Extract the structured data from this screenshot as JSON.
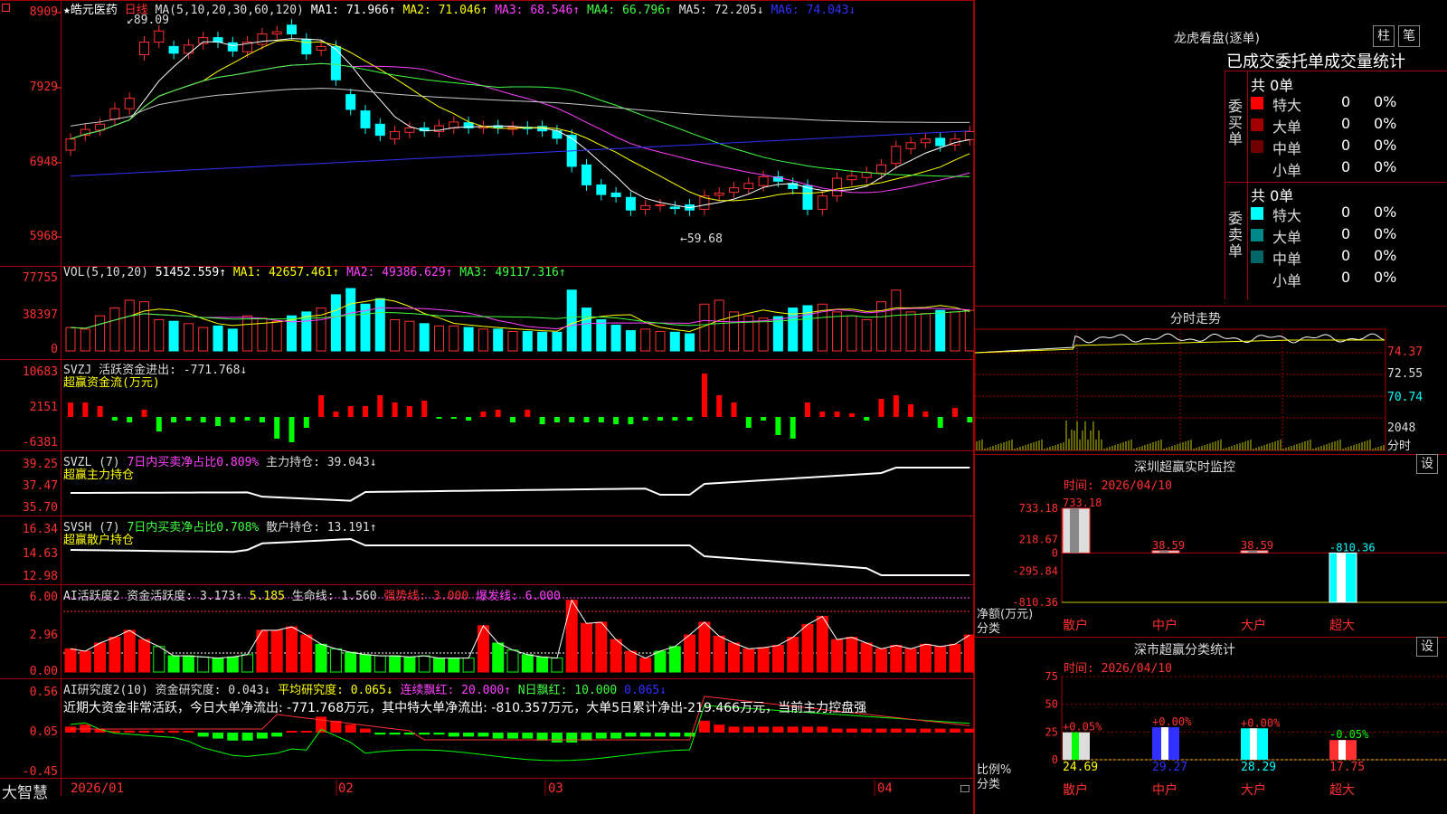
{
  "stock": {
    "name": "★皓元医药",
    "period": "日线"
  },
  "price_panel": {
    "y_labels": [
      "8909",
      "7929",
      "6948",
      "5968"
    ],
    "ma_header": [
      {
        "text": "MA(5,10,20,30,60,120)",
        "color": "#dddddd"
      },
      {
        "text": "MA1: 71.966↑",
        "color": "#ffffff"
      },
      {
        "text": "MA2: 71.046↑",
        "color": "#ffff00"
      },
      {
        "text": "MA3: 68.546↑",
        "color": "#ff40ff"
      },
      {
        "text": "MA4: 66.796↑",
        "color": "#40ff40"
      },
      {
        "text": "MA5: 72.205↓",
        "color": "#dddddd"
      },
      {
        "text": "MA6: 74.043↓",
        "color": "#3030ff"
      }
    ],
    "high_mark": "89.09",
    "low_mark": "←59.68"
  },
  "vol_panel": {
    "y_labels": [
      "77755",
      "38397",
      "0"
    ],
    "header": [
      {
        "text": "VOL(5,10,20)",
        "color": "#dddddd"
      },
      {
        "text": "51452.559↑",
        "color": "#ffffff"
      },
      {
        "text": "MA1: 42657.461↑",
        "color": "#ffff00"
      },
      {
        "text": "MA2: 49386.629↑",
        "color": "#ff40ff"
      },
      {
        "text": "MA3: 49117.316↑",
        "color": "#40ff40"
      }
    ]
  },
  "svzj_panel": {
    "y_labels": [
      "10683",
      "2151",
      "-6381"
    ],
    "header": [
      {
        "text": "SVZJ  活跃资金进出: -771.768↓",
        "color": "#dddddd"
      }
    ],
    "subtitle": "超赢资金流(万元)"
  },
  "svzl_panel": {
    "y_labels": [
      "39.25",
      "37.47",
      "35.70"
    ],
    "header": [
      {
        "text": "SVZL (7)",
        "color": "#dddddd"
      },
      {
        "text": "7日内买卖净占比0.809%",
        "color": "#ff40ff"
      },
      {
        "text": "主力持仓: 39.043↓",
        "color": "#dddddd"
      }
    ],
    "subtitle": "超赢主力持仓"
  },
  "svsh_panel": {
    "y_labels": [
      "16.34",
      "14.63",
      "12.98"
    ],
    "header": [
      {
        "text": "SVSH (7)",
        "color": "#dddddd"
      },
      {
        "text": "7日内买卖净占比0.708%",
        "color": "#40ff40"
      },
      {
        "text": "散户持仓: 13.191↑",
        "color": "#dddddd"
      }
    ],
    "subtitle": "超赢散户持仓"
  },
  "ai_active_panel": {
    "y_labels": [
      "6.00",
      "2.96",
      "0.00"
    ],
    "header": [
      {
        "text": "AI活跃度2",
        "color": "#dddddd"
      },
      {
        "text": "资金活跃度: 3.173↑",
        "color": "#dddddd"
      },
      {
        "text": "5.185",
        "color": "#ffff00"
      },
      {
        "text": "生命线: 1.560",
        "color": "#dddddd"
      },
      {
        "text": "强势线: 3.000",
        "color": "#ff3030"
      },
      {
        "text": "爆发线: 6.000",
        "color": "#ff40ff"
      }
    ]
  },
  "ai_research_panel": {
    "y_labels": [
      "0.56",
      "0.05",
      "-0.45"
    ],
    "header": [
      {
        "text": "AI研究度2(10)",
        "color": "#dddddd"
      },
      {
        "text": "资金研究度: 0.043↓",
        "color": "#dddddd"
      },
      {
        "text": "平均研究度: 0.065↓",
        "color": "#ffff00"
      },
      {
        "text": "连续飘红: 20.000↑",
        "color": "#ff40ff"
      },
      {
        "text": "N日飘红: 10.000",
        "color": "#40ff40"
      },
      {
        "text": "0.065↓",
        "color": "#3030ff"
      }
    ],
    "comment": "近期大资金非常活跃，今日大单净流出: -771.768万元，其中特大单净流出: -810.357万元，大单5日累计净出-219.466万元，当前主力控盘强"
  },
  "x_axis": {
    "brand": "大智慧",
    "labels": [
      "2026/01",
      "02",
      "03",
      "04"
    ]
  },
  "right": {
    "lhb_title": "龙虎看盘(逐单)",
    "btn_zhu": "柱",
    "btn_bi": "笔",
    "order_title": "已成交委托单成交量统计",
    "buy_label": "委买单",
    "sell_label": "委卖单",
    "buy_total": "共 0单",
    "sell_total": "共 0单",
    "buy_rows": [
      {
        "label": "特大",
        "count": "0",
        "pct": "0%",
        "color": "#ff0000"
      },
      {
        "label": "大单",
        "count": "0",
        "pct": "0%",
        "color": "#a00000"
      },
      {
        "label": "中单",
        "count": "0",
        "pct": "0%",
        "color": "#700000"
      },
      {
        "label": "小单",
        "count": "0",
        "pct": "0%",
        "color": "#000000"
      }
    ],
    "sell_rows": [
      {
        "label": "特大",
        "count": "0",
        "pct": "0%",
        "color": "#00ffff"
      },
      {
        "label": "大单",
        "count": "0",
        "pct": "0%",
        "color": "#008888"
      },
      {
        "label": "中单",
        "count": "0",
        "pct": "0%",
        "color": "#006666"
      },
      {
        "label": "小单",
        "count": "0",
        "pct": "0%",
        "color": "#000000"
      }
    ],
    "intraday_title": "分时走势",
    "intraday_labels": [
      "74.37",
      "72.55",
      "70.74",
      "2048",
      "分时"
    ],
    "sz_monitor_title": "深圳超赢实时监控",
    "sz_time": "时间: 2026/04/10",
    "sz_y_labels": [
      "733.18",
      "218.67",
      "0",
      "-295.84",
      "-810.36"
    ],
    "sz_values": [
      733.18,
      38.59,
      38.59,
      -810.36
    ],
    "sz_value_labels": [
      "733.18",
      "38.59",
      "38.59",
      "-810.36"
    ],
    "sz_axis_label": "净额(万元)",
    "sz_axis_label2": "分类",
    "categories": [
      "散户",
      "中户",
      "大户",
      "超大"
    ],
    "set_btn": "设",
    "cls_title": "深市超赢分类统计",
    "cls_time": "时间: 2026/04/10",
    "cls_y_labels": [
      "75",
      "50",
      "25",
      "0"
    ],
    "cls_values": [
      24.69,
      29.27,
      28.29,
      17.75
    ],
    "cls_value_labels": [
      "24.69",
      "29.27",
      "28.29",
      "17.75"
    ],
    "cls_change_labels": [
      "+0.05%",
      "+0.00%",
      "+0.00%",
      "-0.05%"
    ],
    "cls_axis_label": "比例%",
    "cls_axis_label2": "分类"
  }
}
